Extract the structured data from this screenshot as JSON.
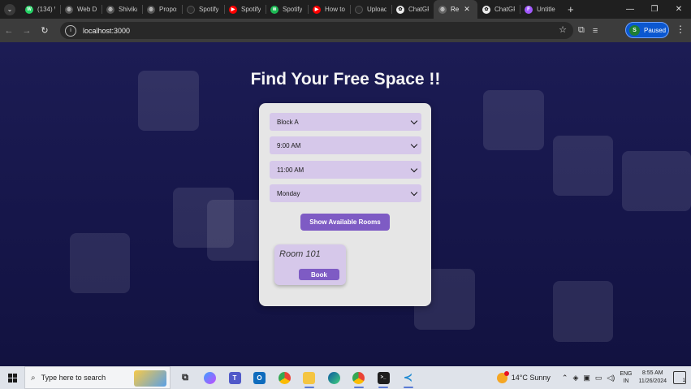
{
  "browser": {
    "tabs": [
      {
        "title": "(134) W",
        "icon": "whatsapp-icon",
        "color": "#25d366",
        "glyph": "W"
      },
      {
        "title": "Web D",
        "icon": "globe-icon",
        "color": "#555555",
        "glyph": "◎"
      },
      {
        "title": "Shivika",
        "icon": "globe-icon",
        "color": "#555555",
        "glyph": "◎"
      },
      {
        "title": "Propos",
        "icon": "globe-icon",
        "color": "#555555",
        "glyph": "◎"
      },
      {
        "title": "Spotify",
        "icon": "loading-icon",
        "color": "#2a2a2a",
        "glyph": ""
      },
      {
        "title": "Spotify",
        "icon": "youtube-icon",
        "color": "#ff0000",
        "glyph": "▶"
      },
      {
        "title": "Spotify",
        "icon": "spotify-icon",
        "color": "#1db954",
        "glyph": "≋"
      },
      {
        "title": "How to",
        "icon": "youtube-icon",
        "color": "#ff0000",
        "glyph": "▶"
      },
      {
        "title": "Upload",
        "icon": "loading-icon",
        "color": "#2a2a2a",
        "glyph": ""
      },
      {
        "title": "ChatGP",
        "icon": "chatgpt-icon",
        "color": "#ececec",
        "glyph": "✿"
      },
      {
        "title": "Re",
        "icon": "globe-icon",
        "color": "#666666",
        "glyph": "◎",
        "active": true
      },
      {
        "title": "ChatGP",
        "icon": "chatgpt-icon",
        "color": "#ececec",
        "glyph": "✿"
      },
      {
        "title": "Untitle",
        "icon": "figma-icon",
        "color": "#a259ff",
        "glyph": "F"
      }
    ],
    "url": "localhost:3000",
    "profile_initial": "S",
    "profile_status": "Paused"
  },
  "page": {
    "title": "Find Your Free Space !!",
    "filters": {
      "block": "Block A",
      "start_time": "9:00 AM",
      "end_time": "11:00 AM",
      "day": "Monday"
    },
    "show_button": "Show Available Rooms",
    "rooms": [
      {
        "name": "Room 101",
        "book_label": "Book"
      }
    ]
  },
  "taskbar": {
    "search_placeholder": "Type here to search",
    "weather": "14°C  Sunny",
    "language_top": "ENG",
    "language_bottom": "IN",
    "time": "8:55 AM",
    "date": "11/26/2024",
    "notification_count": "1"
  },
  "colors": {
    "page_bg": "#1c1c54",
    "card_bg": "#e6e6e6",
    "select_bg": "#d6c8ea",
    "accent_purple": "#7e5bc4"
  }
}
